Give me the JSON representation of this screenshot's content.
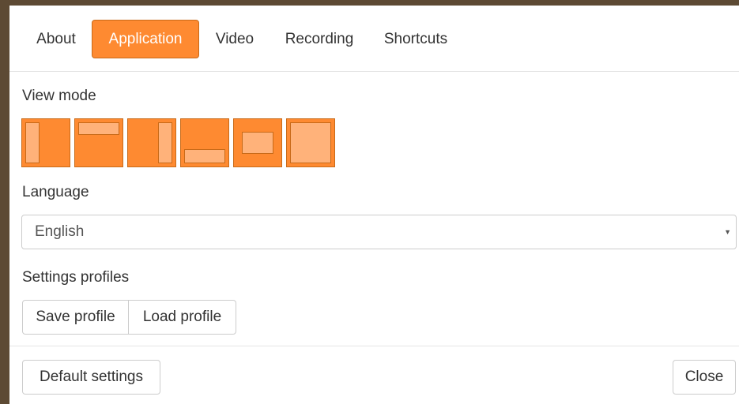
{
  "tabs": [
    {
      "label": "About",
      "active": false
    },
    {
      "label": "Application",
      "active": true
    },
    {
      "label": "Video",
      "active": false
    },
    {
      "label": "Recording",
      "active": false
    },
    {
      "label": "Shortcuts",
      "active": false
    }
  ],
  "view_mode": {
    "label": "View mode",
    "options": [
      {
        "icon": "layout-left-panel-icon"
      },
      {
        "icon": "layout-top-panel-icon"
      },
      {
        "icon": "layout-right-panel-icon"
      },
      {
        "icon": "layout-bottom-panel-icon"
      },
      {
        "icon": "layout-center-window-icon"
      },
      {
        "icon": "layout-fullscreen-icon"
      }
    ]
  },
  "language": {
    "label": "Language",
    "selected": "English"
  },
  "profiles": {
    "label": "Settings profiles",
    "save_label": "Save profile",
    "load_label": "Load profile"
  },
  "footer": {
    "default_label": "Default settings",
    "close_label": "Close"
  },
  "colors": {
    "accent": "#fe8a31",
    "accent_border": "#c86a18",
    "accent_light": "#ffb27a"
  }
}
